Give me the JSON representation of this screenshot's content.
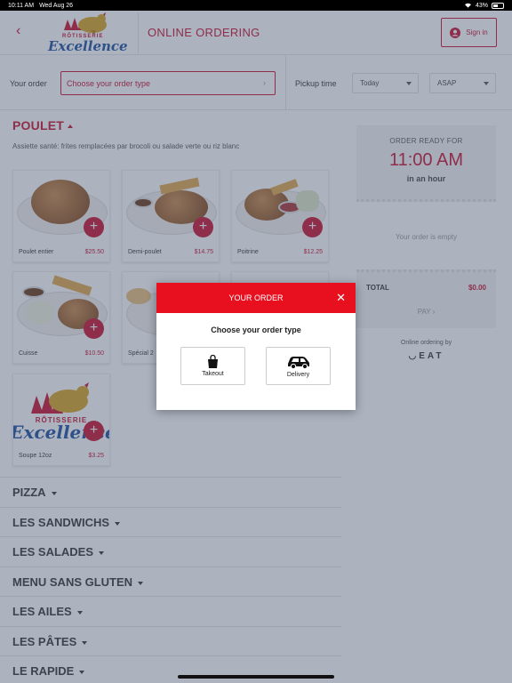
{
  "status": {
    "time": "10:11 AM",
    "date": "Wed Aug 26",
    "battery": "43%"
  },
  "header": {
    "logo_small": "RÔTISSERIE",
    "logo_big": "Excellence",
    "title": "ONLINE ORDERING",
    "signin_label": "Sign in"
  },
  "orderbar": {
    "your_order_label": "Your order",
    "order_type_placeholder": "Choose your order type",
    "pickup_label": "Pickup time",
    "day_value": "Today",
    "time_value": "ASAP"
  },
  "section": {
    "title": "POULET",
    "description": "Assiette santé: frites remplacées par brocoli ou salade verte ou riz blanc"
  },
  "items": [
    {
      "name": "Poulet entier",
      "price": "$25.50"
    },
    {
      "name": "Demi-poulet",
      "price": "$14.75"
    },
    {
      "name": "Poitrine",
      "price": "$12.25"
    },
    {
      "name": "Cuisse",
      "price": "$10.50"
    },
    {
      "name": "Spécial 2",
      "price": ""
    },
    {
      "name": "Soupe 12oz",
      "price": "$3.25"
    }
  ],
  "categories": [
    "PIZZA",
    "LES SANDWICHS",
    "LES SALADES",
    "MENU SANS GLUTEN",
    "LES AILES",
    "LES PÂTES",
    "LE RAPIDE"
  ],
  "sidebar": {
    "ready_label": "ORDER READY FOR",
    "ready_time": "11:00 AM",
    "ready_eta": "in an hour",
    "empty_text": "Your order is empty",
    "total_label": "TOTAL",
    "total_value": "$0.00",
    "pay_label": "PAY",
    "powered_label": "Online ordering by",
    "powered_brand": "EAT"
  },
  "modal": {
    "title": "YOUR ORDER",
    "question": "Choose your order type",
    "option_takeout": "Takeout",
    "option_delivery": "Delivery"
  },
  "colors": {
    "accent": "#c8102e",
    "modal_header": "#e8101f",
    "overlay": "#46556e"
  }
}
